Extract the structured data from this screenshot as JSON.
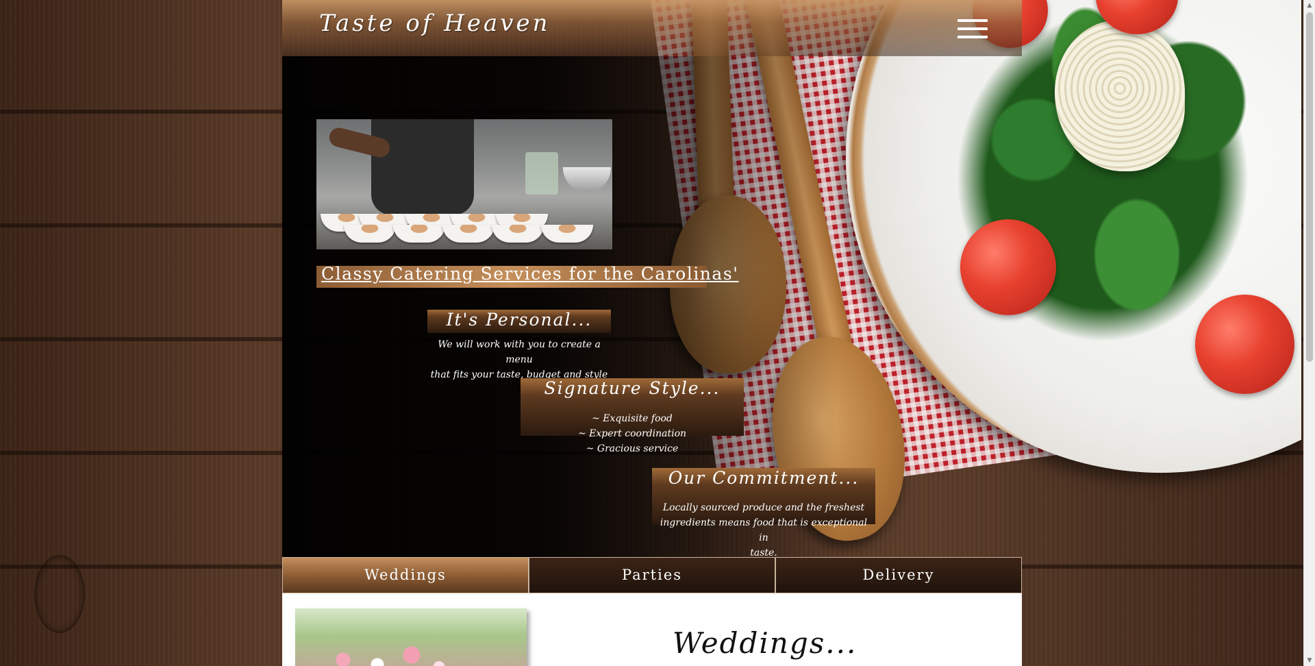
{
  "header": {
    "logo": "Taste of Heaven",
    "menu_icon": "hamburger-menu-icon"
  },
  "hero": {
    "tagline": "Classy Catering Services for the Carolinas'",
    "features": [
      {
        "title": "It's Personal...",
        "lines": [
          "We will work with you to create a menu",
          "that fits your taste, budget and style"
        ]
      },
      {
        "title": "Signature Style...",
        "lines": [
          "~ Exquisite food",
          "~ Expert coordination",
          "~ Gracious service"
        ]
      },
      {
        "title": "Our Commitment...",
        "lines": [
          "Locally sourced produce and the freshest",
          "ingredients means food that is exceptional in",
          "taste."
        ]
      }
    ]
  },
  "tabs": [
    {
      "label": "Weddings",
      "active": true
    },
    {
      "label": "Parties",
      "active": false
    },
    {
      "label": "Delivery",
      "active": false
    }
  ],
  "panel": {
    "heading": "Weddings..."
  },
  "colors": {
    "wood": "#4a2f20",
    "accent_copper": "#c58f5b",
    "hero_overlay": "#000000",
    "panel_bg": "#ffffff"
  }
}
